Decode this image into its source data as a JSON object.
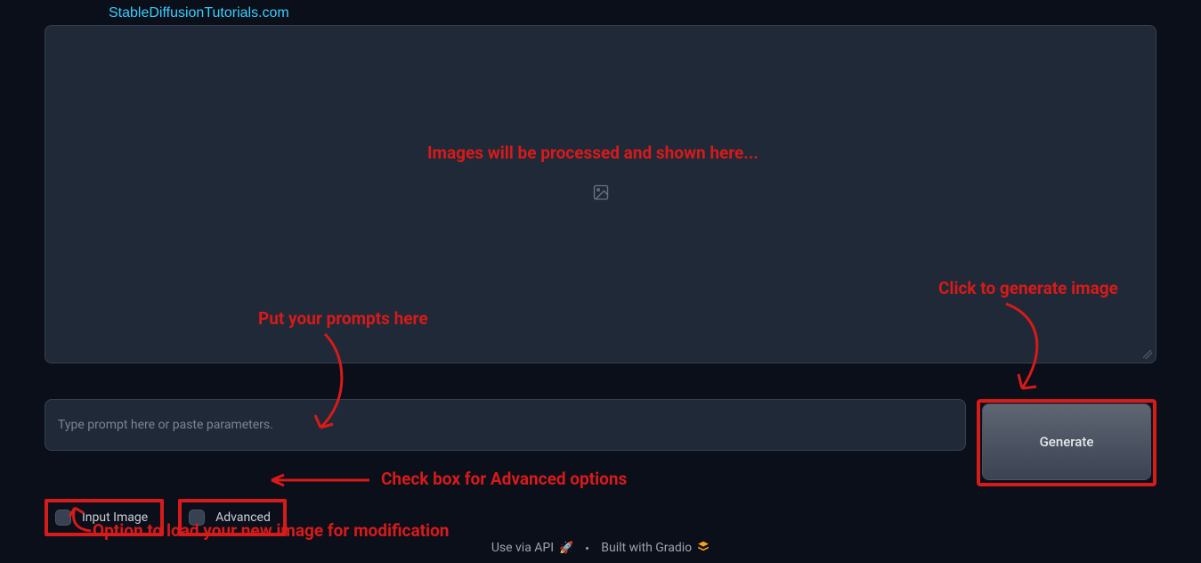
{
  "branding": {
    "watermark": "StableDiffusionTutorials.com"
  },
  "preview": {
    "icon": "image-icon"
  },
  "prompt": {
    "placeholder": "Type prompt here or paste parameters.",
    "value": ""
  },
  "generate": {
    "label": "Generate"
  },
  "options": {
    "input_image": {
      "label": "Input Image",
      "checked": false
    },
    "advanced": {
      "label": "Advanced",
      "checked": false
    }
  },
  "annotations": {
    "preview": "Images will be processed and shown here...",
    "prompt": "Put your prompts here",
    "generate": "Click to generate image",
    "advanced": "Check box for Advanced options",
    "input_image": "Option to load your new image for modification"
  },
  "footer": {
    "api": "Use via API",
    "built": "Built with Gradio"
  }
}
